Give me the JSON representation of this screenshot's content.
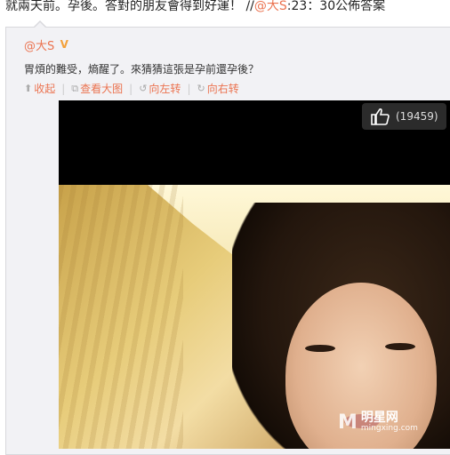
{
  "post": {
    "text_prefix": "就兩天前。孕後。答對的朋友會得到好運！ //",
    "mention": "@大S",
    "text_suffix": ":23：30公佈答案"
  },
  "repost": {
    "author": "@大S",
    "verified_badge": "V",
    "body": "胃煩的難受，熵醒了。來猜猜這張是孕前還孕後？",
    "actions": [
      {
        "icon": "up-arrow-icon",
        "label": "收起"
      },
      {
        "icon": "expand-image-icon",
        "label": "查看大图"
      },
      {
        "icon": "rotate-left-icon",
        "label": "向左转"
      },
      {
        "icon": "rotate-right-icon",
        "label": "向右转"
      }
    ]
  },
  "like": {
    "icon": "thumbs-up-icon",
    "count": "(19459)"
  },
  "watermark": {
    "logo": "M",
    "cn": "明星网",
    "en": "mingxing.com"
  },
  "colors": {
    "accent": "#eb7350",
    "panel_bg": "#f2f2f5"
  }
}
